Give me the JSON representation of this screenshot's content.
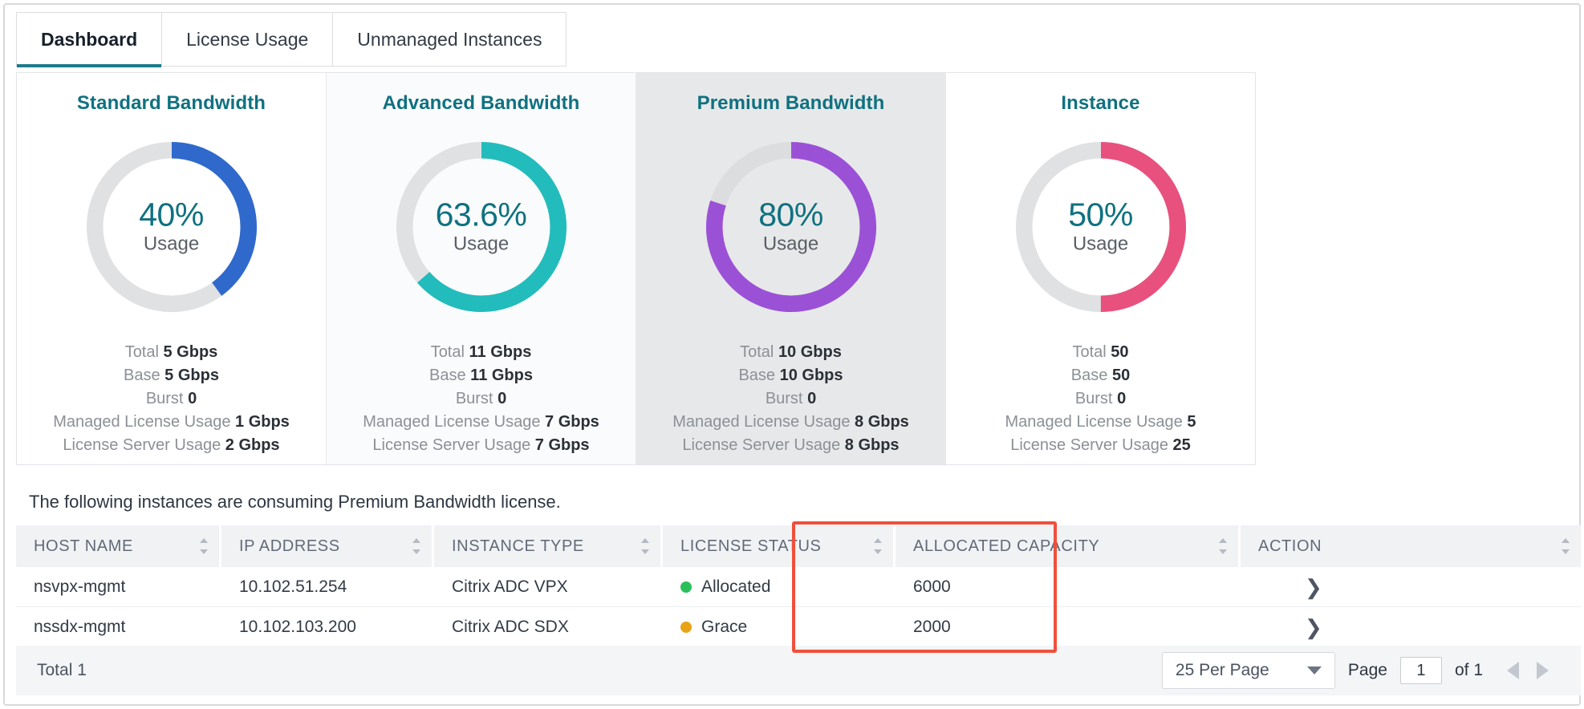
{
  "tabs": [
    {
      "label": "Dashboard",
      "active": true
    },
    {
      "label": "License Usage",
      "active": false
    },
    {
      "label": "Unmanaged Instances",
      "active": false
    }
  ],
  "cards": [
    {
      "title": "Standard Bandwidth",
      "percent_label": "40%",
      "usage_label": "Usage",
      "percent_value": 40,
      "color": "#3069cc",
      "track_color": "#e0e1e3",
      "background": "#ffffff",
      "stats": [
        {
          "label": "Total",
          "value": "5 Gbps"
        },
        {
          "label": "Base",
          "value": "5 Gbps"
        },
        {
          "label": "Burst",
          "value": "0"
        },
        {
          "label": "Managed License Usage",
          "value": "1 Gbps"
        },
        {
          "label": "License Server Usage",
          "value": "2 Gbps"
        }
      ]
    },
    {
      "title": "Advanced Bandwidth",
      "percent_label": "63.6%",
      "usage_label": "Usage",
      "percent_value": 63.6,
      "color": "#22bcbc",
      "track_color": "#e0e1e3",
      "background": "#fafbfc",
      "stats": [
        {
          "label": "Total",
          "value": "11 Gbps"
        },
        {
          "label": "Base",
          "value": "11 Gbps"
        },
        {
          "label": "Burst",
          "value": "0"
        },
        {
          "label": "Managed License Usage",
          "value": "7 Gbps"
        },
        {
          "label": "License Server Usage",
          "value": "7 Gbps"
        }
      ]
    },
    {
      "title": "Premium Bandwidth",
      "percent_label": "80%",
      "usage_label": "Usage",
      "percent_value": 80,
      "color": "#9b51d6",
      "track_color": "#dcdddf",
      "background": "#e7e8e9",
      "selected": true,
      "stats": [
        {
          "label": "Total",
          "value": "10 Gbps"
        },
        {
          "label": "Base",
          "value": "10 Gbps"
        },
        {
          "label": "Burst",
          "value": "0"
        },
        {
          "label": "Managed License Usage",
          "value": "8 Gbps"
        },
        {
          "label": "License Server Usage",
          "value": "8 Gbps"
        }
      ]
    },
    {
      "title": "Instance",
      "percent_label": "50%",
      "usage_label": "Usage",
      "percent_value": 50,
      "color": "#e8507e",
      "track_color": "#e0e1e3",
      "background": "#ffffff",
      "stats": [
        {
          "label": "Total",
          "value": "50"
        },
        {
          "label": "Base",
          "value": "50"
        },
        {
          "label": "Burst",
          "value": "0"
        },
        {
          "label": "Managed License Usage",
          "value": "5"
        },
        {
          "label": "License Server Usage",
          "value": "25"
        }
      ]
    }
  ],
  "note": "The following instances are consuming Premium Bandwidth license.",
  "table": {
    "columns": [
      {
        "label": "HOST NAME",
        "key": "host"
      },
      {
        "label": "IP ADDRESS",
        "key": "ip"
      },
      {
        "label": "INSTANCE TYPE",
        "key": "type"
      },
      {
        "label": "LICENSE STATUS",
        "key": "status"
      },
      {
        "label": "ALLOCATED CAPACITY",
        "key": "capacity"
      },
      {
        "label": "ACTION",
        "key": "action"
      }
    ],
    "rows": [
      {
        "host": "nsvpx-mgmt",
        "ip": "10.102.51.254",
        "type": "Citrix ADC VPX",
        "status": "Allocated",
        "status_color": "#2bbf5a",
        "capacity": "6000",
        "action_icon": "chevron-right-icon"
      },
      {
        "host": "nssdx-mgmt",
        "ip": "10.102.103.200",
        "type": "Citrix ADC SDX",
        "status": "Grace",
        "status_color": "#e8a317",
        "capacity": "2000",
        "action_icon": "chevron-right-icon"
      }
    ]
  },
  "footer": {
    "total_label": "Total",
    "total_value": "1",
    "per_page": "25 Per Page",
    "page_label": "Page",
    "page_value": "1",
    "of_label": "of 1"
  },
  "highlight": {
    "color": "#f0503c",
    "target": "LICENSE STATUS"
  }
}
